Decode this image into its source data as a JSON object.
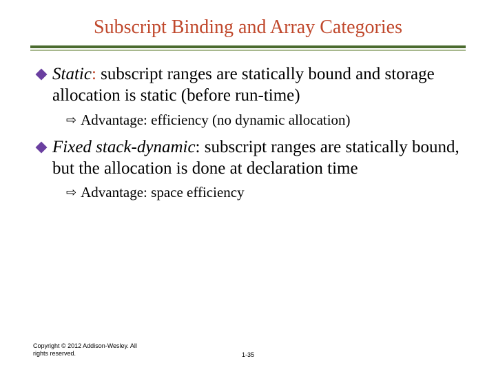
{
  "title": "Subscript Binding and Array Categories",
  "items": [
    {
      "term": "Static",
      "colon_accent": true,
      "body": " subscript ranges are statically bound and storage allocation is static (before run-time)",
      "sub": "Advantage: efficiency (no dynamic allocation)"
    },
    {
      "term": "Fixed stack-dynamic",
      "colon_accent": false,
      "body": ": subscript ranges are statically bound, but the allocation is done at declaration time",
      "sub": "Advantage: space efficiency"
    }
  ],
  "footer": {
    "copyright": "Copyright © 2012 Addison-Wesley. All rights reserved.",
    "pagenum": "1-35"
  }
}
